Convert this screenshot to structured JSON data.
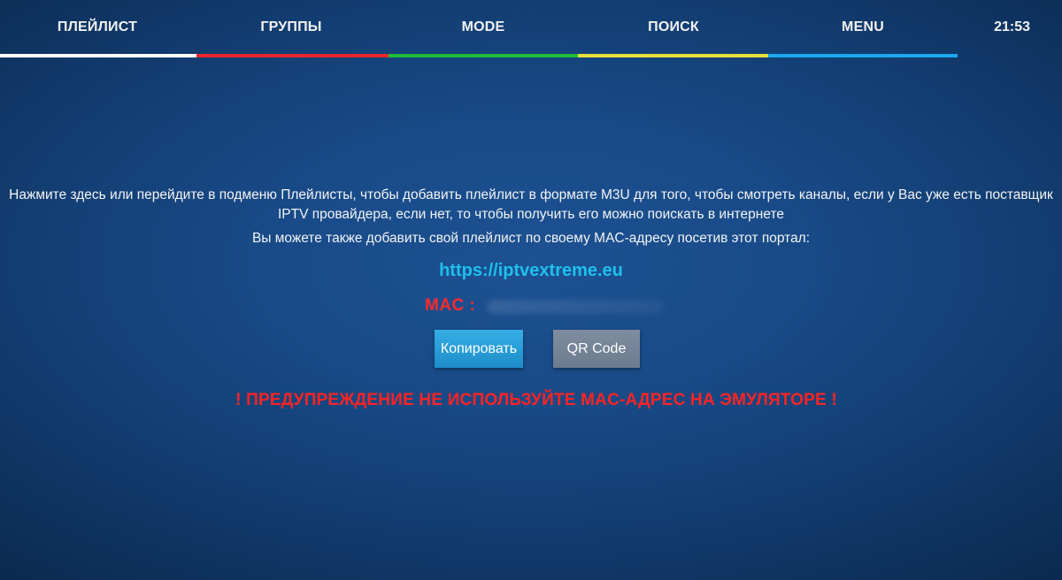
{
  "topbar": {
    "tabs": [
      {
        "label": "ПЛЕЙЛИСТ",
        "color": "#ffffff"
      },
      {
        "label": "ГРУППЫ",
        "color": "#e8262d"
      },
      {
        "label": "MODE",
        "color": "#1ebc3a"
      },
      {
        "label": "ПОИСК",
        "color": "#e7e03c"
      },
      {
        "label": "MENU",
        "color": "#1ba8ee"
      }
    ],
    "clock": "21:53"
  },
  "main": {
    "info_line_1": "Нажмите здесь или перейдите в подменю Плейлисты, чтобы добавить плейлист в формате M3U для того, чтобы смотреть каналы, если у Вас уже есть поставщик IPTV провайдера, если нет, то чтобы получить его можно поискать в интернете",
    "info_line_2": "Вы можете также добавить свой плейлист по своему MAC-адресу посетив этот портал:",
    "portal_link": "https://iptvextreme.eu",
    "mac_label": "MAC :",
    "copy_button": "Копировать",
    "qr_button": "QR Code",
    "warning": "! ПРЕДУПРЕЖДЕНИЕ НЕ ИСПОЛЬЗУЙТЕ MAC-АДРЕС НА ЭМУЛЯТОРЕ !"
  },
  "colors": {
    "accent_link": "#1fc0ee",
    "warning": "#ff2323",
    "copy_button": "#2a9fd9",
    "qr_button": "#7786a0"
  }
}
